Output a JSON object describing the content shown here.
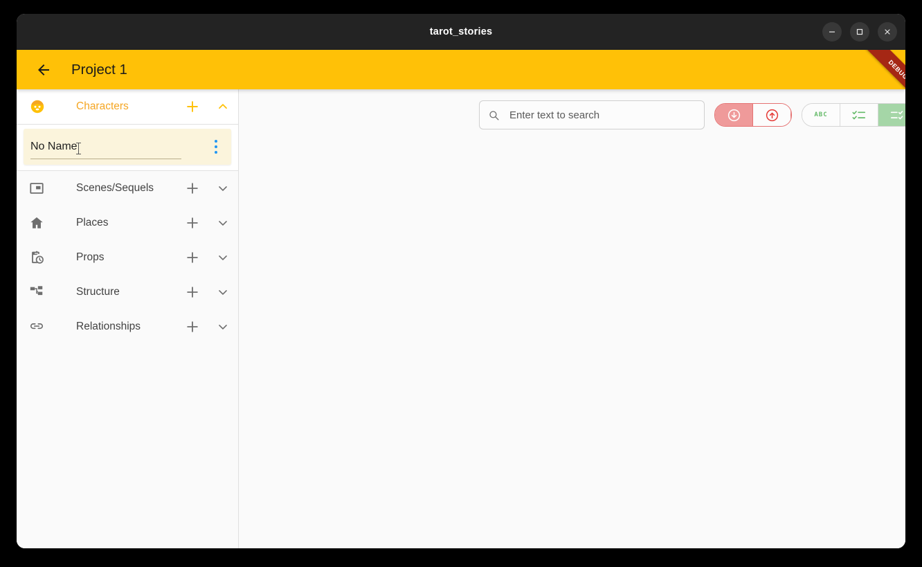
{
  "window": {
    "title": "tarot_stories",
    "controls": [
      {
        "name": "minimize",
        "glyph": "minimize-icon"
      },
      {
        "name": "maximize",
        "glyph": "maximize-icon"
      },
      {
        "name": "close",
        "glyph": "close-icon"
      }
    ]
  },
  "appbar": {
    "back_icon": "arrow-back-icon",
    "title": "Project 1",
    "debug_banner": "DEBUG",
    "background_color": "#FFC107",
    "banner_color": "#A52714"
  },
  "sidebar": {
    "sections": [
      {
        "label": "Characters",
        "icon": "face-icon",
        "add_icon": "plus-icon",
        "chevron": "chevron-up-icon",
        "expanded": true,
        "accent_color": "#F5A623"
      },
      {
        "label": "Scenes/Sequels",
        "icon": "slideshow-icon",
        "add_icon": "plus-icon",
        "chevron": "chevron-down-icon",
        "expanded": false
      },
      {
        "label": "Places",
        "icon": "home-icon",
        "add_icon": "plus-icon",
        "chevron": "chevron-down-icon",
        "expanded": false
      },
      {
        "label": "Props",
        "icon": "pending-actions-icon",
        "add_icon": "plus-icon",
        "chevron": "chevron-down-icon",
        "expanded": false
      },
      {
        "label": "Structure",
        "icon": "account-tree-icon",
        "add_icon": "plus-icon",
        "chevron": "chevron-down-icon",
        "expanded": false
      },
      {
        "label": "Relationships",
        "icon": "link-icon",
        "add_icon": "plus-icon",
        "chevron": "chevron-down-icon",
        "expanded": false
      }
    ],
    "character_item": {
      "name_value": "No Name",
      "menu_icon": "more-vert-icon",
      "background_color": "#FBF4DC",
      "menu_color": "#2196F3"
    }
  },
  "toolbar": {
    "search": {
      "icon": "search-icon",
      "value": "",
      "placeholder": "Enter text to search"
    },
    "sort_group": {
      "accent_color": "#E57373",
      "buttons": [
        {
          "name": "sort-descending",
          "icon": "arrow-circle-down-icon",
          "selected": true
        },
        {
          "name": "sort-ascending",
          "icon": "arrow-circle-up-icon",
          "selected": false
        }
      ]
    },
    "view_group": {
      "accent_color": "#66BB6A",
      "buttons": [
        {
          "name": "abc-view",
          "icon": "abc-icon",
          "label": "ABC",
          "selected": false
        },
        {
          "name": "checklist-left-view",
          "icon": "checklist-rtl-icon",
          "selected": false
        },
        {
          "name": "checklist-right-view",
          "icon": "checklist-icon",
          "selected": true
        }
      ]
    }
  }
}
